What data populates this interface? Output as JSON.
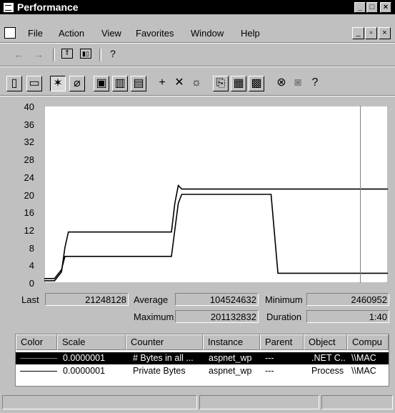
{
  "window": {
    "title": "Performance",
    "caption_buttons": {
      "minimize": "_",
      "maximize": "□",
      "close": "×"
    },
    "child_buttons": {
      "minimize": "_",
      "restore": "▫",
      "close": "×"
    }
  },
  "menu": {
    "items": [
      "File",
      "Action",
      "View",
      "Favorites",
      "Window",
      "Help"
    ]
  },
  "chart_data": {
    "type": "line",
    "y_ticks": [
      "40",
      "36",
      "32",
      "28",
      "24",
      "20",
      "16",
      "12",
      "8",
      "4",
      "0"
    ],
    "ylim": [
      0,
      40
    ],
    "series": [
      {
        "name": "# Bytes in all Heaps",
        "color": "#000000",
        "x": [
          0,
          3,
          5,
          6,
          7,
          37,
          38,
          39,
          40,
          92,
          100
        ],
        "values": [
          0.5,
          0.5,
          2.5,
          8,
          11.5,
          11.5,
          18,
          22,
          21.2,
          21.2,
          21.2
        ]
      },
      {
        "name": "Private Bytes",
        "color": "#000000",
        "x": [
          0,
          3,
          5,
          6,
          7,
          37,
          38,
          39,
          40,
          66,
          68,
          92,
          100
        ],
        "values": [
          1,
          1,
          3,
          6,
          6,
          6,
          12,
          18,
          20,
          20,
          2.2,
          2.2,
          2.2
        ]
      }
    ],
    "cursor_x": 92
  },
  "stats": {
    "last_label": "Last",
    "last_value": "21248128",
    "average_label": "Average",
    "average_value": "104524632",
    "minimum_label": "Minimum",
    "minimum_value": "2460952",
    "maximum_label": "Maximum",
    "maximum_value": "201132832",
    "duration_label": "Duration",
    "duration_value": "1:40"
  },
  "legend": {
    "headers": [
      "Color",
      "Scale",
      "Counter",
      "Instance",
      "Parent",
      "Object",
      "Compu"
    ],
    "rows": [
      {
        "scale": "0.0000001",
        "counter": "# Bytes in all ...",
        "instance": "aspnet_wp",
        "parent": "---",
        "object": ".NET C...",
        "computer": "\\\\MAC",
        "selected": true
      },
      {
        "scale": "0.0000001",
        "counter": "Private Bytes",
        "instance": "aspnet_wp",
        "parent": "---",
        "object": "Process",
        "computer": "\\\\MAC",
        "selected": false
      }
    ]
  }
}
